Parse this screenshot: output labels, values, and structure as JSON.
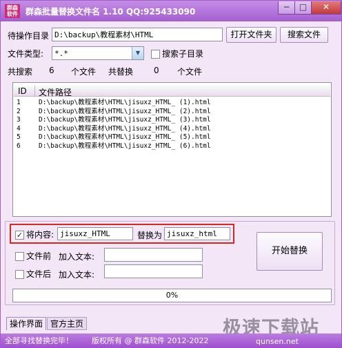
{
  "window": {
    "logo_text_1": "群森",
    "logo_text_2": "软件",
    "title": "群森批量替换文件名  1.10 QQ:925433090",
    "minimize_glyph": "−",
    "maximize_glyph": "□",
    "close_glyph": "✕"
  },
  "target": {
    "label": "待操作目录",
    "value": "D:\\backup\\教程素材\\HTML",
    "open_folder_button": "打开文件夹",
    "search_button": "搜索文件"
  },
  "filetype": {
    "label": "文件类型:",
    "value": "*.*",
    "dropdown_glyph": "▼",
    "search_subdirs_label": "搜索子目录",
    "search_subdirs_checked": false
  },
  "summary": {
    "total_search_label": "共搜索",
    "total_search_count": "6",
    "total_search_unit": "个文件",
    "total_replace_label": "共替换",
    "total_replace_count": "0",
    "total_replace_unit": "个文件"
  },
  "file_list": {
    "headers": {
      "id": "ID",
      "path": "文件路径"
    },
    "rows": [
      {
        "id": "1",
        "path": "D:\\backup\\教程素材\\HTML\\jisuxz_HTML_ (1).html"
      },
      {
        "id": "2",
        "path": "D:\\backup\\教程素材\\HTML\\jisuxz_HTML_ (2).html"
      },
      {
        "id": "3",
        "path": "D:\\backup\\教程素材\\HTML\\jisuxz_HTML_ (3).html"
      },
      {
        "id": "4",
        "path": "D:\\backup\\教程素材\\HTML\\jisuxz_HTML_ (4).html"
      },
      {
        "id": "5",
        "path": "D:\\backup\\教程素材\\HTML\\jisuxz_HTML_ (5).html"
      },
      {
        "id": "6",
        "path": "D:\\backup\\教程素材\\HTML\\jisuxz_HTML_ (6).html"
      }
    ]
  },
  "options": {
    "replace_content_label": "将内容:",
    "replace_content_checked": true,
    "replace_from_value": "jisuxz_HTML",
    "replace_with_label": "替换为",
    "replace_to_value": "jisuxz_html",
    "prefix_label": "文件前",
    "prefix_checked": false,
    "prefix_add_label": "加入文本:",
    "prefix_value": "",
    "suffix_label": "文件后",
    "suffix_checked": false,
    "suffix_add_label": "加入文本:",
    "suffix_value": "",
    "start_button": "开始替换",
    "checkmark_glyph": "✓"
  },
  "progress": {
    "text": "0%",
    "fraction": 0
  },
  "tabs": [
    {
      "label": "操作界面"
    },
    {
      "label": "官方主页"
    }
  ],
  "status": {
    "message": "全部寻找替换完毕！",
    "copyright": "版权所有 @ 群森软件 2012-2022"
  },
  "watermark": {
    "text": "极速下载站",
    "url": "qunsen.net"
  }
}
